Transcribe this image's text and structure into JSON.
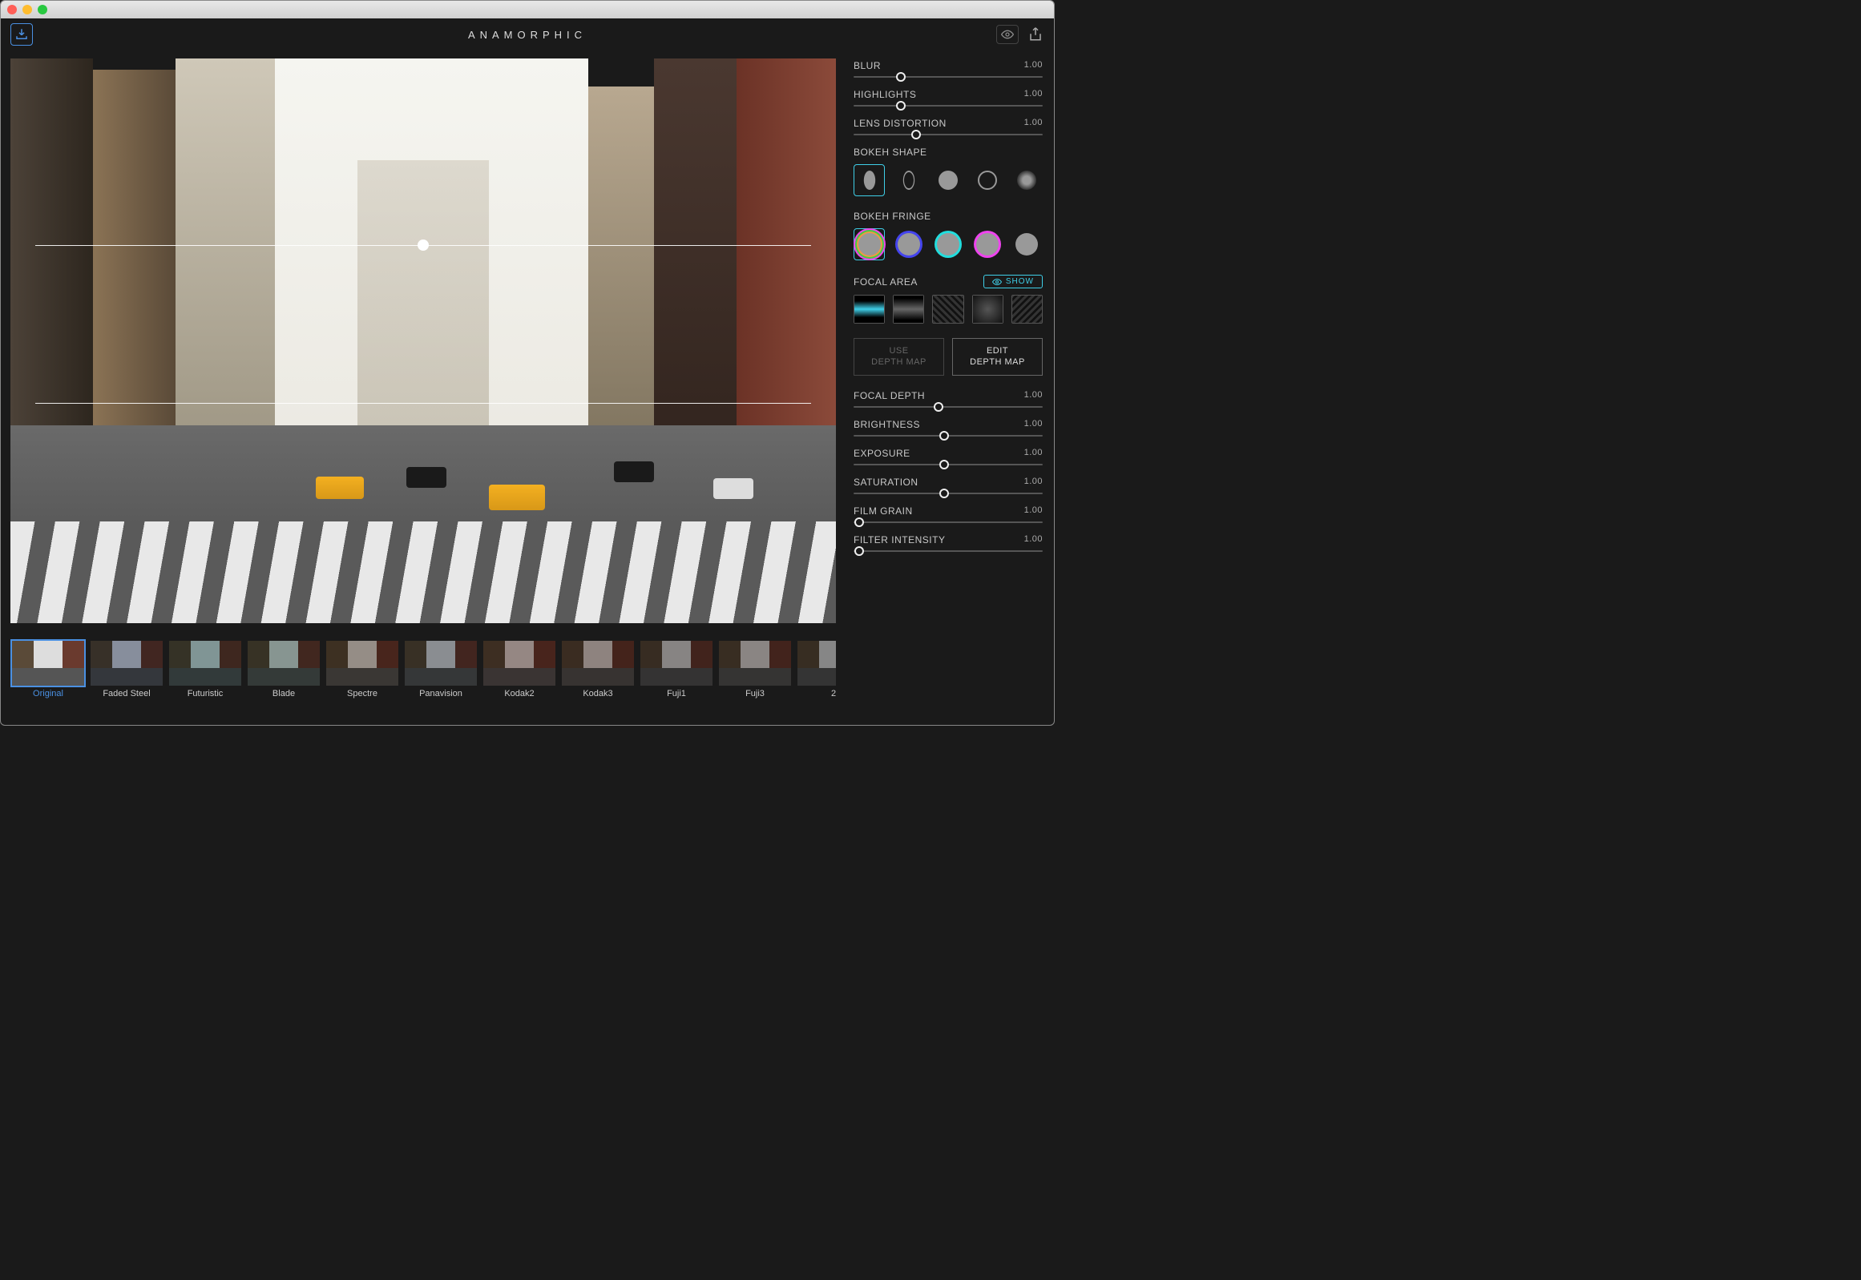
{
  "app": {
    "title": "ANAMORPHIC"
  },
  "sliders": {
    "blur": {
      "label": "BLUR",
      "value": "1.00",
      "pos": 25
    },
    "highlights": {
      "label": "HIGHLIGHTS",
      "value": "1.00",
      "pos": 25
    },
    "lens_distortion": {
      "label": "LENS DISTORTION",
      "value": "1.00",
      "pos": 33
    },
    "focal_depth": {
      "label": "FOCAL DEPTH",
      "value": "1.00",
      "pos": 45
    },
    "brightness": {
      "label": "BRIGHTNESS",
      "value": "1.00",
      "pos": 48
    },
    "exposure": {
      "label": "EXPOSURE",
      "value": "1.00",
      "pos": 48
    },
    "saturation": {
      "label": "SATURATION",
      "value": "1.00",
      "pos": 48
    },
    "film_grain": {
      "label": "FILM GRAIN",
      "value": "1.00",
      "pos": 3
    },
    "filter_intensity": {
      "label": "FILTER INTENSITY",
      "value": "1.00",
      "pos": 3
    }
  },
  "sections": {
    "bokeh_shape": "BOKEH SHAPE",
    "bokeh_fringe": "BOKEH FRINGE",
    "focal_area": "FOCAL AREA"
  },
  "buttons": {
    "show": "SHOW",
    "use_depth_line1": "USE",
    "use_depth_line2": "DEPTH MAP",
    "edit_depth_line1": "EDIT",
    "edit_depth_line2": "DEPTH MAP"
  },
  "presets": [
    {
      "label": "Original",
      "selected": true,
      "tint": "none"
    },
    {
      "label": "Faded Steel",
      "selected": false,
      "tint": "#3a4a6a"
    },
    {
      "label": "Futuristic",
      "selected": false,
      "tint": "#2a5a5a"
    },
    {
      "label": "Blade",
      "selected": false,
      "tint": "#3a5a50"
    },
    {
      "label": "Spectre",
      "selected": false,
      "tint": "#5a4838"
    },
    {
      "label": "Panavision",
      "selected": false,
      "tint": "#404850"
    },
    {
      "label": "Kodak2",
      "selected": false,
      "tint": "#5a3a30"
    },
    {
      "label": "Kodak3",
      "selected": false,
      "tint": "#4a3028"
    },
    {
      "label": "Fuji1",
      "selected": false,
      "tint": "#3a3230"
    },
    {
      "label": "Fuji3",
      "selected": false,
      "tint": "#403530"
    },
    {
      "label": "2",
      "selected": false,
      "tint": "#383838"
    }
  ],
  "bokeh_shapes": [
    {
      "name": "oval-filled",
      "selected": true
    },
    {
      "name": "oval-outline",
      "selected": false
    },
    {
      "name": "circle-filled",
      "selected": false
    },
    {
      "name": "circle-outline",
      "selected": false
    },
    {
      "name": "circle-soft",
      "selected": false
    }
  ],
  "bokeh_fringe": [
    {
      "name": "rainbow",
      "selected": true
    },
    {
      "name": "blue",
      "selected": false
    },
    {
      "name": "cyan",
      "selected": false
    },
    {
      "name": "magenta",
      "selected": false
    },
    {
      "name": "none",
      "selected": false
    }
  ],
  "focal_area_options": [
    {
      "name": "linear-sharp",
      "selected": true
    },
    {
      "name": "linear-soft",
      "selected": false
    },
    {
      "name": "pattern-1",
      "selected": false
    },
    {
      "name": "pattern-2",
      "selected": false
    },
    {
      "name": "pattern-3",
      "selected": false
    }
  ],
  "colors": {
    "accent_blue": "#4a90e2",
    "accent_cyan": "#3fcfe8"
  }
}
